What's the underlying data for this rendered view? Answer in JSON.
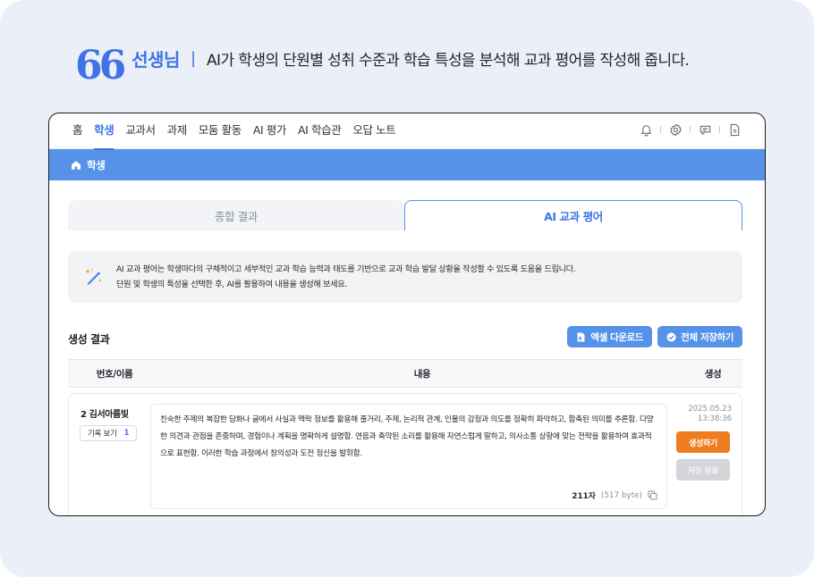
{
  "caption": {
    "quote": "66",
    "role": "선생님",
    "separator": "|",
    "description": "AI가 학생의 단원별 성취 수준과 학습 특성을 분석해 교과 평어를 작성해 줍니다."
  },
  "nav": {
    "items": [
      "홈",
      "학생",
      "교과서",
      "과제",
      "모둠 활동",
      "AI 평가",
      "AI 학습관",
      "오답 노트"
    ],
    "active_index": 1,
    "icons": [
      "bell-icon",
      "settings-icon",
      "chat-icon",
      "document-icon"
    ]
  },
  "breadcrumb": {
    "label": "학생",
    "icon": "home-icon"
  },
  "tabs": [
    {
      "label": "종합 결과",
      "active": false
    },
    {
      "label": "AI 교과 평어",
      "active": true
    }
  ],
  "info": {
    "icon": "magic-pen-icon",
    "line1": "AI 교과 평어는 학생마다의 구체적이고 세부적인 교과 학습 능력과 태도를 기반으로 교과 학습 발달 상황을 작성할 수 있도록 도움을 드립니다.",
    "line2": "단원 및 학생의 특성을 선택한 후, AI를 활용하여 내용을 생성해 보세요."
  },
  "section": {
    "title": "생성 결과",
    "excel_button": "엑셀 다운로드",
    "save_all_button": "전체 저장하기"
  },
  "table": {
    "headers": {
      "name": "번호/이름",
      "content": "내용",
      "generate": "생성"
    },
    "rows": [
      {
        "name": "2 김서아름빛",
        "record_label": "기록 보기",
        "record_count": "1",
        "content": "친숙한 주제의 복잡한 담화나 글에서 사실과 맥락 정보를 활용해 줄거리, 주제, 논리적 관계, 인물의 감정과 의도를 정확히 파악하고, 함축된 의미를 추론함. 다양한 의견과 관점을 존중하며, 경험이나 계획을 명확하게 설명함. 연음과 축약된 소리를 활용해 자연스럽게 말하고, 의사소통 상황에 맞는 전략을 활용하여 효과적으로 표현함. 이러한 학습 과정에서 창의성과 도전 정신을 발휘함.",
        "char_count": "211자",
        "byte_count": "(517 byte)",
        "date": "2025.05.23",
        "time": "13:38:36",
        "generate_label": "생성하기",
        "saved_label": "저장 완료"
      }
    ]
  },
  "colors": {
    "accent": "#3f73e6",
    "subbar": "#5592e8",
    "generate": "#ee7d1f",
    "background": "#eaeff8"
  }
}
